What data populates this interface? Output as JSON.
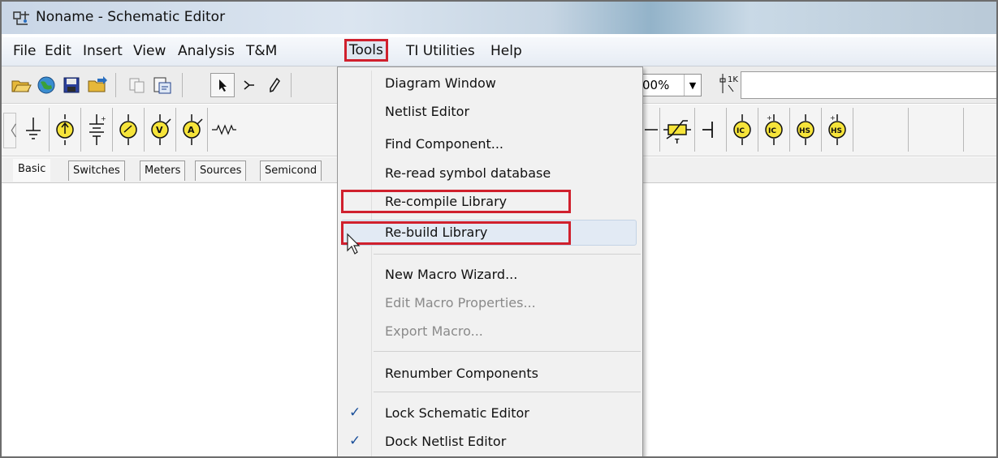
{
  "window": {
    "title": "Noname - Schematic Editor"
  },
  "menubar": {
    "items": [
      "File",
      "Edit",
      "Insert",
      "View",
      "Analysis",
      "T&M",
      "Tools",
      "TI Utilities",
      "Help"
    ]
  },
  "toolbar": {
    "zoom_value": "00%"
  },
  "tabs": [
    "Basic",
    "Switches",
    "Meters",
    "Sources",
    "Semicond"
  ],
  "tools_menu": {
    "items": [
      {
        "label": "Diagram Window"
      },
      {
        "label": "Netlist Editor"
      },
      {
        "label": "Find Component..."
      },
      {
        "label": "Re-read symbol database"
      },
      {
        "label": "Re-compile Library"
      },
      {
        "label": "Re-build Library"
      },
      {
        "label": "New Macro Wizard..."
      },
      {
        "label": "Edit Macro Properties..."
      },
      {
        "label": "Export Macro..."
      },
      {
        "label": "Renumber Components"
      },
      {
        "label": "Lock Schematic Editor"
      },
      {
        "label": "Dock Netlist Editor"
      }
    ],
    "checkmark": "✓"
  },
  "colors": {
    "highlight": "#d0202d",
    "accent": "#1a4f9a"
  }
}
